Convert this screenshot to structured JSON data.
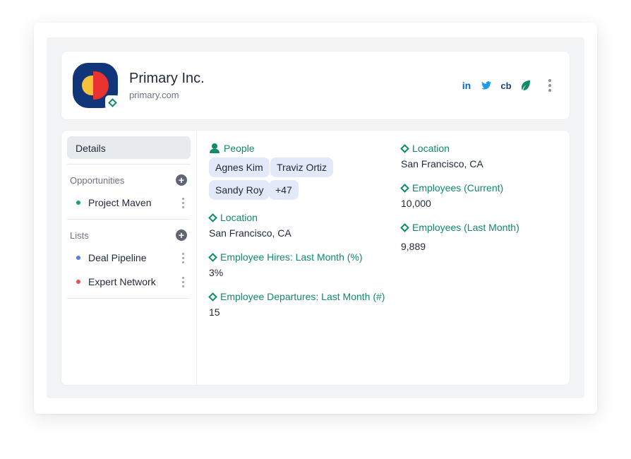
{
  "company": {
    "name": "Primary Inc.",
    "domain": "primary.com"
  },
  "socials": [
    {
      "icon": "linkedin-icon",
      "label": "in",
      "color": "#0a66c2"
    },
    {
      "icon": "twitter-icon",
      "label": "",
      "color": "#1d9bf0"
    },
    {
      "icon": "crunchbase-icon",
      "label": "cb",
      "color": "#1f3f7a"
    },
    {
      "icon": "leaf-icon",
      "label": "",
      "color": "#0f8a6a"
    }
  ],
  "sidebar": {
    "details_tab": "Details",
    "opportunities": {
      "title": "Opportunities",
      "items": [
        {
          "label": "Project Maven",
          "color": "#1aa07a"
        }
      ]
    },
    "lists": {
      "title": "Lists",
      "items": [
        {
          "label": "Deal Pipeline",
          "color": "#5b7ce6"
        },
        {
          "label": "Expert Network",
          "color": "#e5534b"
        }
      ]
    }
  },
  "details": {
    "people": {
      "label": "People",
      "chips": [
        "Agnes Kim",
        "Traviz Ortiz",
        "Sandy Roy",
        "+47"
      ]
    },
    "left_fields": [
      {
        "label": "Location",
        "value": "San Francisco, CA"
      },
      {
        "label": "Employee Hires: Last Month (%)",
        "value": "3%"
      },
      {
        "label": "Employee Departures: Last Month (#)",
        "value": "15"
      }
    ],
    "right_fields": [
      {
        "label": "Location",
        "value": "San Francisco, CA"
      },
      {
        "label": "Employees (Current)",
        "value": "10,000"
      },
      {
        "label": "Employees (Last Month)",
        "value": "9,889"
      }
    ]
  },
  "colors": {
    "accent": "#0f8a6a",
    "logo_bg": "#12357a",
    "chip_bg": "#e3e9f8"
  }
}
